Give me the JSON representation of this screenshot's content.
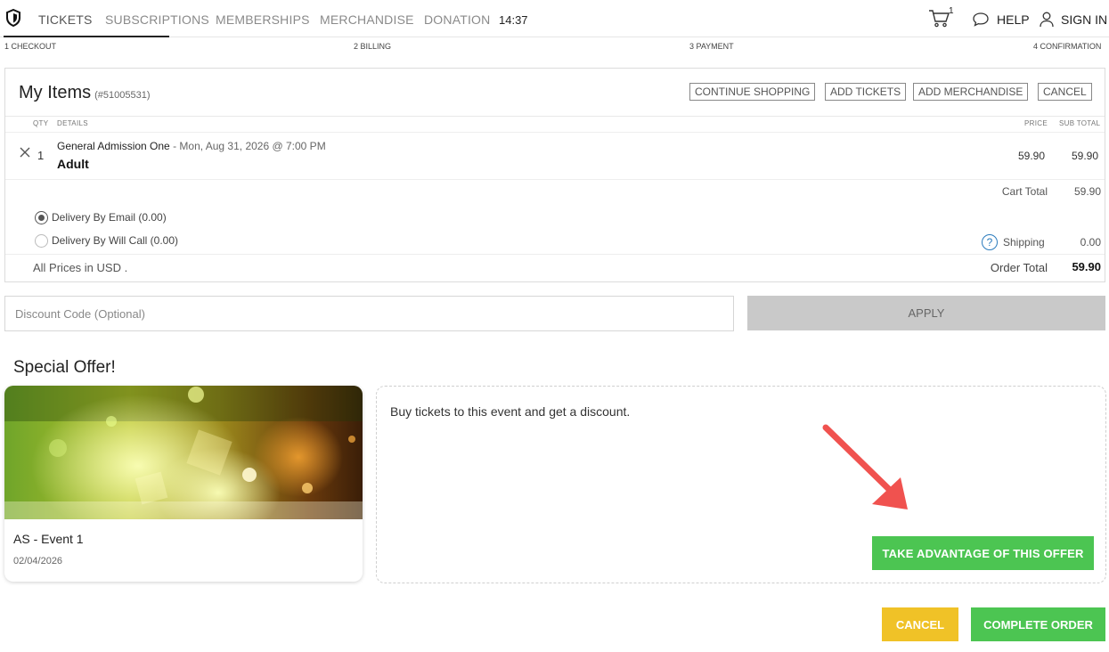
{
  "nav": {
    "items": [
      "TICKETS",
      "SUBSCRIPTIONS",
      "MEMBERSHIPS",
      "MERCHANDISE",
      "DONATION"
    ],
    "clock": "14:37",
    "cart_count": "1",
    "help": "HELP",
    "sign_in": "SIGN IN"
  },
  "steps": [
    "1 CHECKOUT",
    "2 BILLING",
    "3 PAYMENT",
    "4 CONFIRMATION"
  ],
  "items": {
    "title": "My Items",
    "order_number": "(#51005531)",
    "buttons": [
      "CONTINUE SHOPPING",
      "ADD TICKETS",
      "ADD MERCHANDISE",
      "CANCEL"
    ],
    "columns": {
      "qty": "QTY",
      "details": "DETAILS",
      "price": "PRICE",
      "subtotal": "SUB TOTAL"
    },
    "line": {
      "qty": "1",
      "event": "General Admission One",
      "date": " - Mon, Aug 31, 2026 @ 7:00 PM",
      "type": "Adult",
      "price": "59.90",
      "subtotal": "59.90"
    },
    "cart_total_label": "Cart Total",
    "cart_total": "59.90",
    "delivery": [
      "Delivery By Email (0.00)",
      "Delivery By Will Call (0.00)"
    ],
    "delivery_selected": 0,
    "shipping_label": "Shipping",
    "shipping": "0.00",
    "currency_note": "All Prices in USD .",
    "order_total_label": "Order Total",
    "order_total": "59.90"
  },
  "discount": {
    "placeholder": "Discount Code (Optional)",
    "apply": "APPLY"
  },
  "special": {
    "title": "Special Offer!",
    "event_name": "AS - Event 1",
    "event_date": "02/04/2026",
    "text": "Buy tickets to this event and get a discount.",
    "cta": "TAKE ADVANTAGE OF THIS OFFER"
  },
  "footer": {
    "cancel": "CANCEL",
    "complete": "COMPLETE ORDER"
  },
  "colors": {
    "green": "#4cc552",
    "yellow": "#f0c227",
    "arrow": "#f0524f",
    "link": "#2b7bbd"
  }
}
